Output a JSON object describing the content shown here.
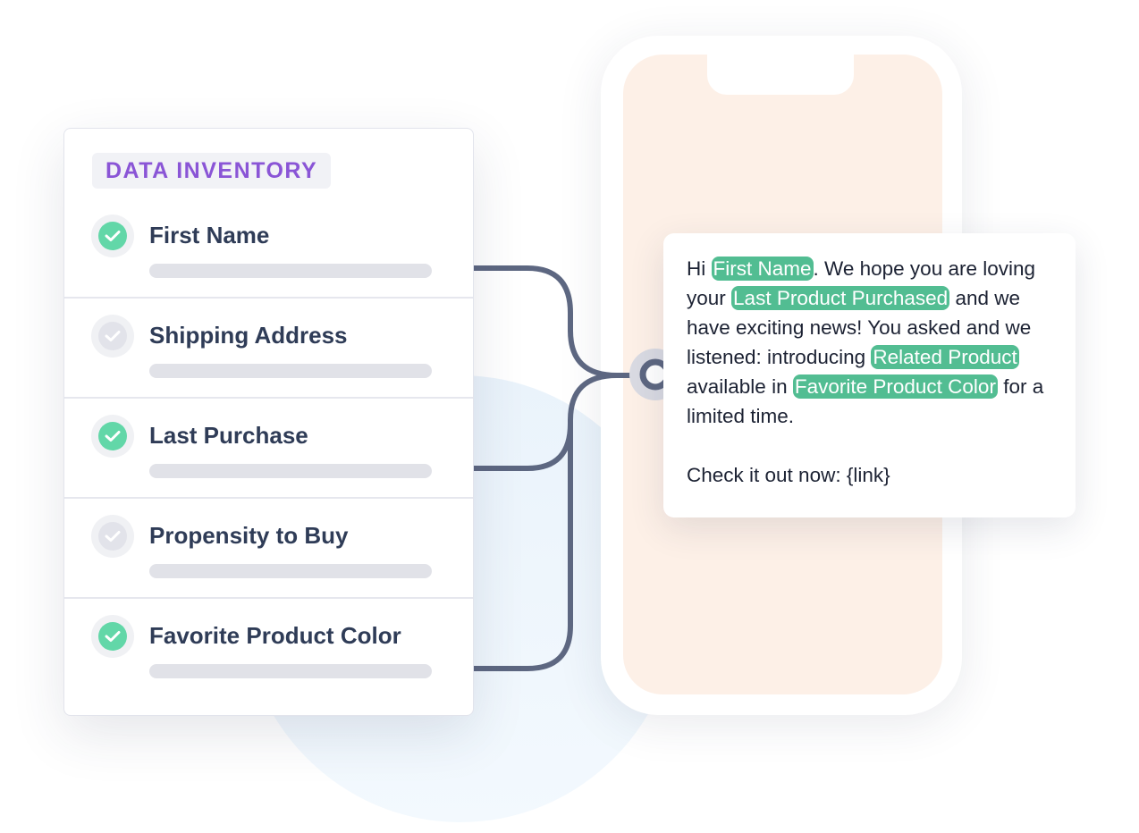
{
  "inventory": {
    "title": "DATA INVENTORY",
    "items": [
      {
        "label": "First Name",
        "checked": true
      },
      {
        "label": "Shipping Address",
        "checked": false
      },
      {
        "label": "Last Purchase",
        "checked": true
      },
      {
        "label": "Propensity to Buy",
        "checked": false
      },
      {
        "label": "Favorite Product Color",
        "checked": true
      }
    ]
  },
  "message": {
    "greeting": "Hi",
    "tag_first_name": "First Name",
    "text_1": ". We hope you are loving your",
    "tag_last_product": "Last Product Purchased",
    "text_2": "and we have exciting news! You asked and we listened: introducing",
    "tag_related_product": "Related Product",
    "text_3": "available in",
    "tag_favorite_color": "Favorite Product Color",
    "text_4": "for a limited time.",
    "cta": "Check it out now: {link}"
  },
  "colors": {
    "accent_purple": "#8a55d6",
    "check_green": "#62d7a8",
    "tag_green": "#52bd92",
    "wire": "#5d6781",
    "phone_screen": "#fdf0e7"
  }
}
